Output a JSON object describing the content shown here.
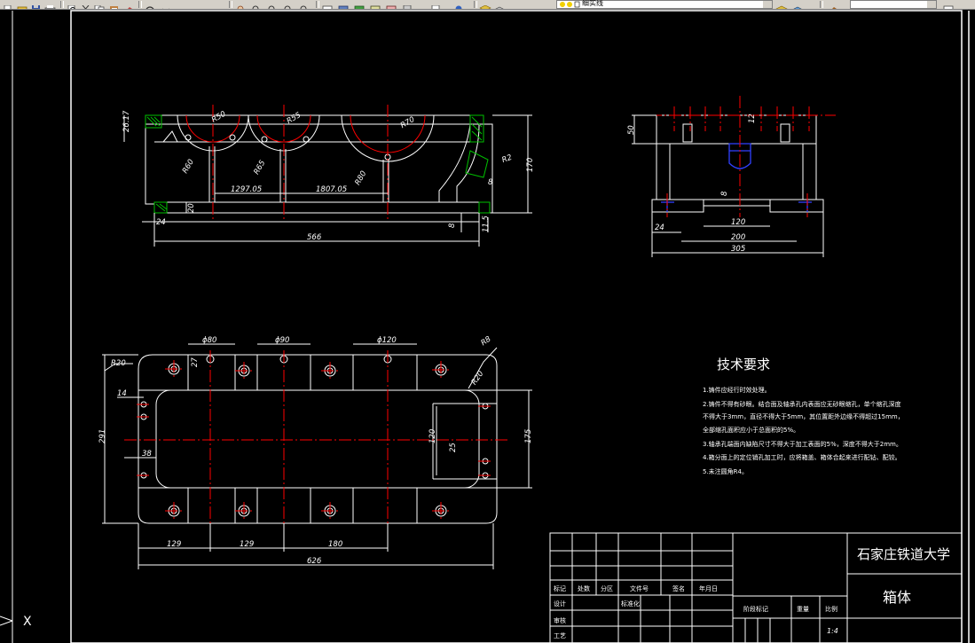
{
  "toolbar": {
    "layer_name": "细实线",
    "icons": [
      "new-icon",
      "open-icon",
      "save-icon",
      "print-icon",
      "preview-icon",
      "cut-icon",
      "copy-icon",
      "paste-icon",
      "match-icon",
      "undo-icon",
      "redo-icon",
      "pan-icon",
      "zoom-realtime-icon",
      "zoom-window-icon",
      "zoom-previous-icon",
      "properties-icon",
      "design-center-icon",
      "tool-palette-icon",
      "sheet-set-icon",
      "markup-icon",
      "calculator-icon",
      "help-icon",
      "layer-manager-icon",
      "layer-state-icon",
      "layer-color-icon",
      "layer-prev-icon",
      "layer-icon",
      "color-icon"
    ]
  },
  "colors": {
    "background": "#000000",
    "outline": "#ffffff",
    "centerline": "#ff0000",
    "hatch": "#00c000",
    "hidden": "#0000ff"
  },
  "drawing": {
    "dims_front": {
      "d_top": "26.17",
      "r50": "R50",
      "r55": "R55",
      "r70": "R70",
      "r60": "R60",
      "r65": "R65",
      "r80": "R80",
      "r2": "R2",
      "d_8a": "8",
      "d_170": "170",
      "d_20": "20",
      "d_24": "24",
      "d_129705": "1297.05",
      "d_180705": "1807.05",
      "d_8b": "8",
      "d_115": "11.5",
      "d_566": "566"
    },
    "dims_side": {
      "d_50": "50",
      "d_12": "12",
      "d_8": "8",
      "d_24": "24",
      "d_120": "120",
      "d_200": "200",
      "d_305": "305"
    },
    "dims_top": {
      "phi80": "ϕ80",
      "phi90": "ϕ90",
      "phi120": "ϕ120",
      "r8": "R8",
      "r20a": "R20",
      "r20b": "R20",
      "d_27": "27",
      "d_14": "14",
      "d_291": "291",
      "d_38": "38",
      "d_120": "120",
      "d_25": "25",
      "d_175": "175",
      "d_129a": "129",
      "d_129b": "129",
      "d_180": "180",
      "d_626": "626"
    },
    "tech_title": "技术要求",
    "tech_notes": [
      "1.铸件应经行时效处理。",
      "2.铸件不得有砂眼。结合面及轴承孔内表面应无砂眼缩孔，单个缩孔深度",
      "不得大于3mm，直径不得大于5mm，其位置距外边缘不得超过15mm，",
      "全部缩孔面积应小于总面积的5%。",
      "3.轴承孔端面内缺陷尺寸不得大于加工表面的5%，深度不得大于2mm。",
      "4.箱分面上的定位销孔加工时，应将箱盖、箱体合起来进行配钻、配铰。",
      "5.未注圆角R4。"
    ],
    "title_block": {
      "school": "石家庄铁道大学",
      "part_name": "箱体",
      "labels": {
        "biaoji": "标记",
        "chushu": "处数",
        "fenqu": "分区",
        "wenjianhao": "文件号",
        "qianming": "签名",
        "nianyueri": "年月日",
        "sheji": "设计",
        "biaozhunhua": "标准化",
        "shenhe": "审核",
        "gongyi": "工艺",
        "jieduan": "阶段标记",
        "zhongliang": "重量",
        "bili": "比例"
      },
      "scale": "1:4"
    },
    "ucs_label": "X"
  }
}
